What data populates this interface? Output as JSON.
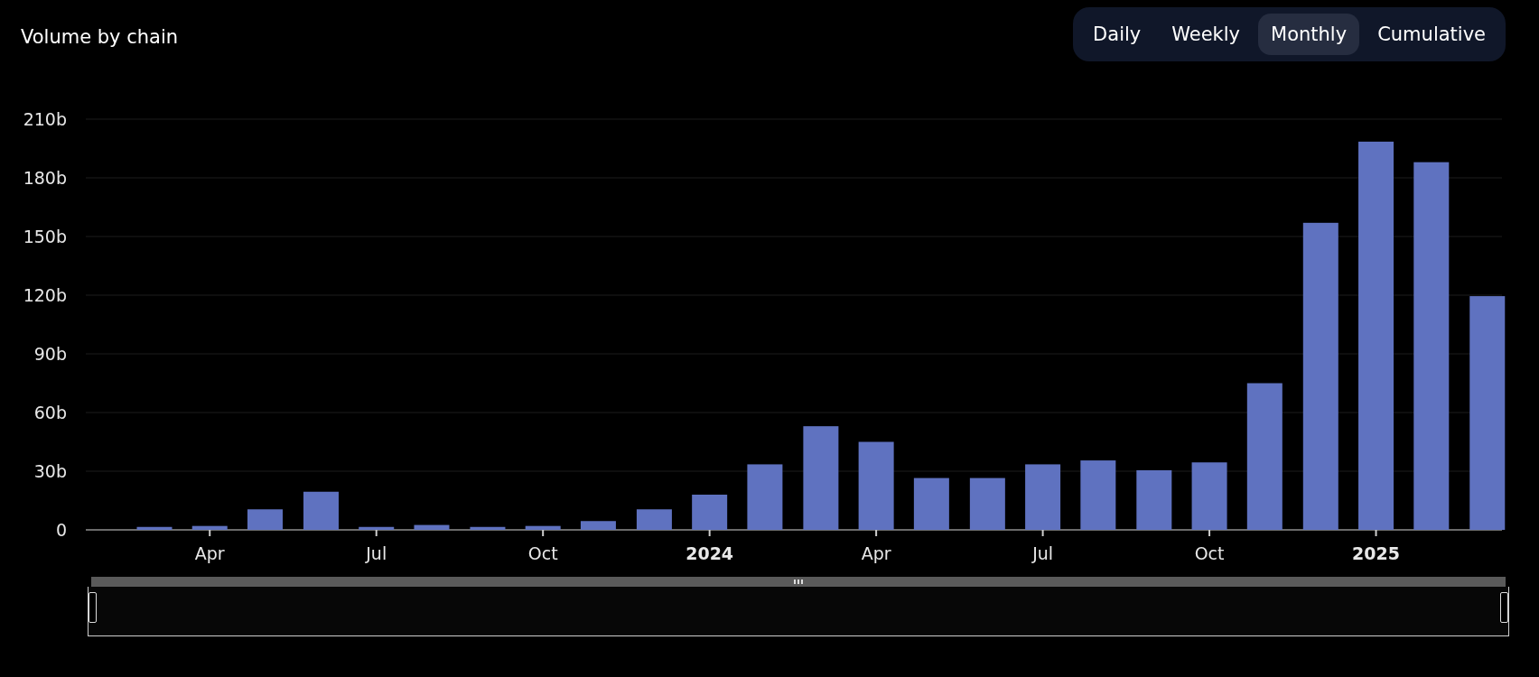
{
  "title": "Volume by chain",
  "tabs": [
    {
      "label": "Daily",
      "selected": false
    },
    {
      "label": "Weekly",
      "selected": false
    },
    {
      "label": "Monthly",
      "selected": true
    },
    {
      "label": "Cumulative",
      "selected": false
    }
  ],
  "chart_data": {
    "type": "bar",
    "grid": true,
    "xlim": [
      2023.064,
      2025.189
    ],
    "x": [
      2023.167,
      2023.25,
      2023.333,
      2023.417,
      2023.5,
      2023.583,
      2023.667,
      2023.75,
      2023.833,
      2023.917,
      2024,
      2024.083,
      2024.167,
      2024.25,
      2024.333,
      2024.417,
      2024.5,
      2024.583,
      2024.667,
      2024.75,
      2024.833,
      2024.917,
      2025,
      2025.083,
      2025.167
    ],
    "series": [
      {
        "color": "#5f72c0",
        "values": [
          1.5,
          2,
          10.5,
          19.5,
          1.5,
          2.5,
          1.5,
          2,
          4.5,
          10.5,
          18,
          33.5,
          53,
          45,
          26.5,
          26.5,
          33.5,
          35.5,
          30.5,
          34.5,
          75,
          157,
          198.5,
          188,
          119.5
        ]
      }
    ],
    "ylim": [
      0,
      210
    ],
    "yticks": [
      {
        "value": 0,
        "label": "0"
      },
      {
        "value": 30,
        "label": "30b"
      },
      {
        "value": 60,
        "label": "60b"
      },
      {
        "value": 90,
        "label": "90b"
      },
      {
        "value": 120,
        "label": "120b"
      },
      {
        "value": 150,
        "label": "150b"
      },
      {
        "value": 180,
        "label": "180b"
      },
      {
        "value": 210,
        "label": "210b"
      }
    ],
    "xticks": [
      {
        "value": 2023.25,
        "label": "Apr"
      },
      {
        "value": 2023.5,
        "label": "Jul"
      },
      {
        "value": 2023.75,
        "label": "Oct"
      },
      {
        "value": 2024,
        "label": "2024"
      },
      {
        "value": 2024.25,
        "label": "Apr"
      },
      {
        "value": 2024.5,
        "label": "Jul"
      },
      {
        "value": 2024.75,
        "label": "Oct"
      },
      {
        "value": 2025,
        "label": "2025"
      }
    ]
  },
  "range_slider": {
    "level": 1
  }
}
